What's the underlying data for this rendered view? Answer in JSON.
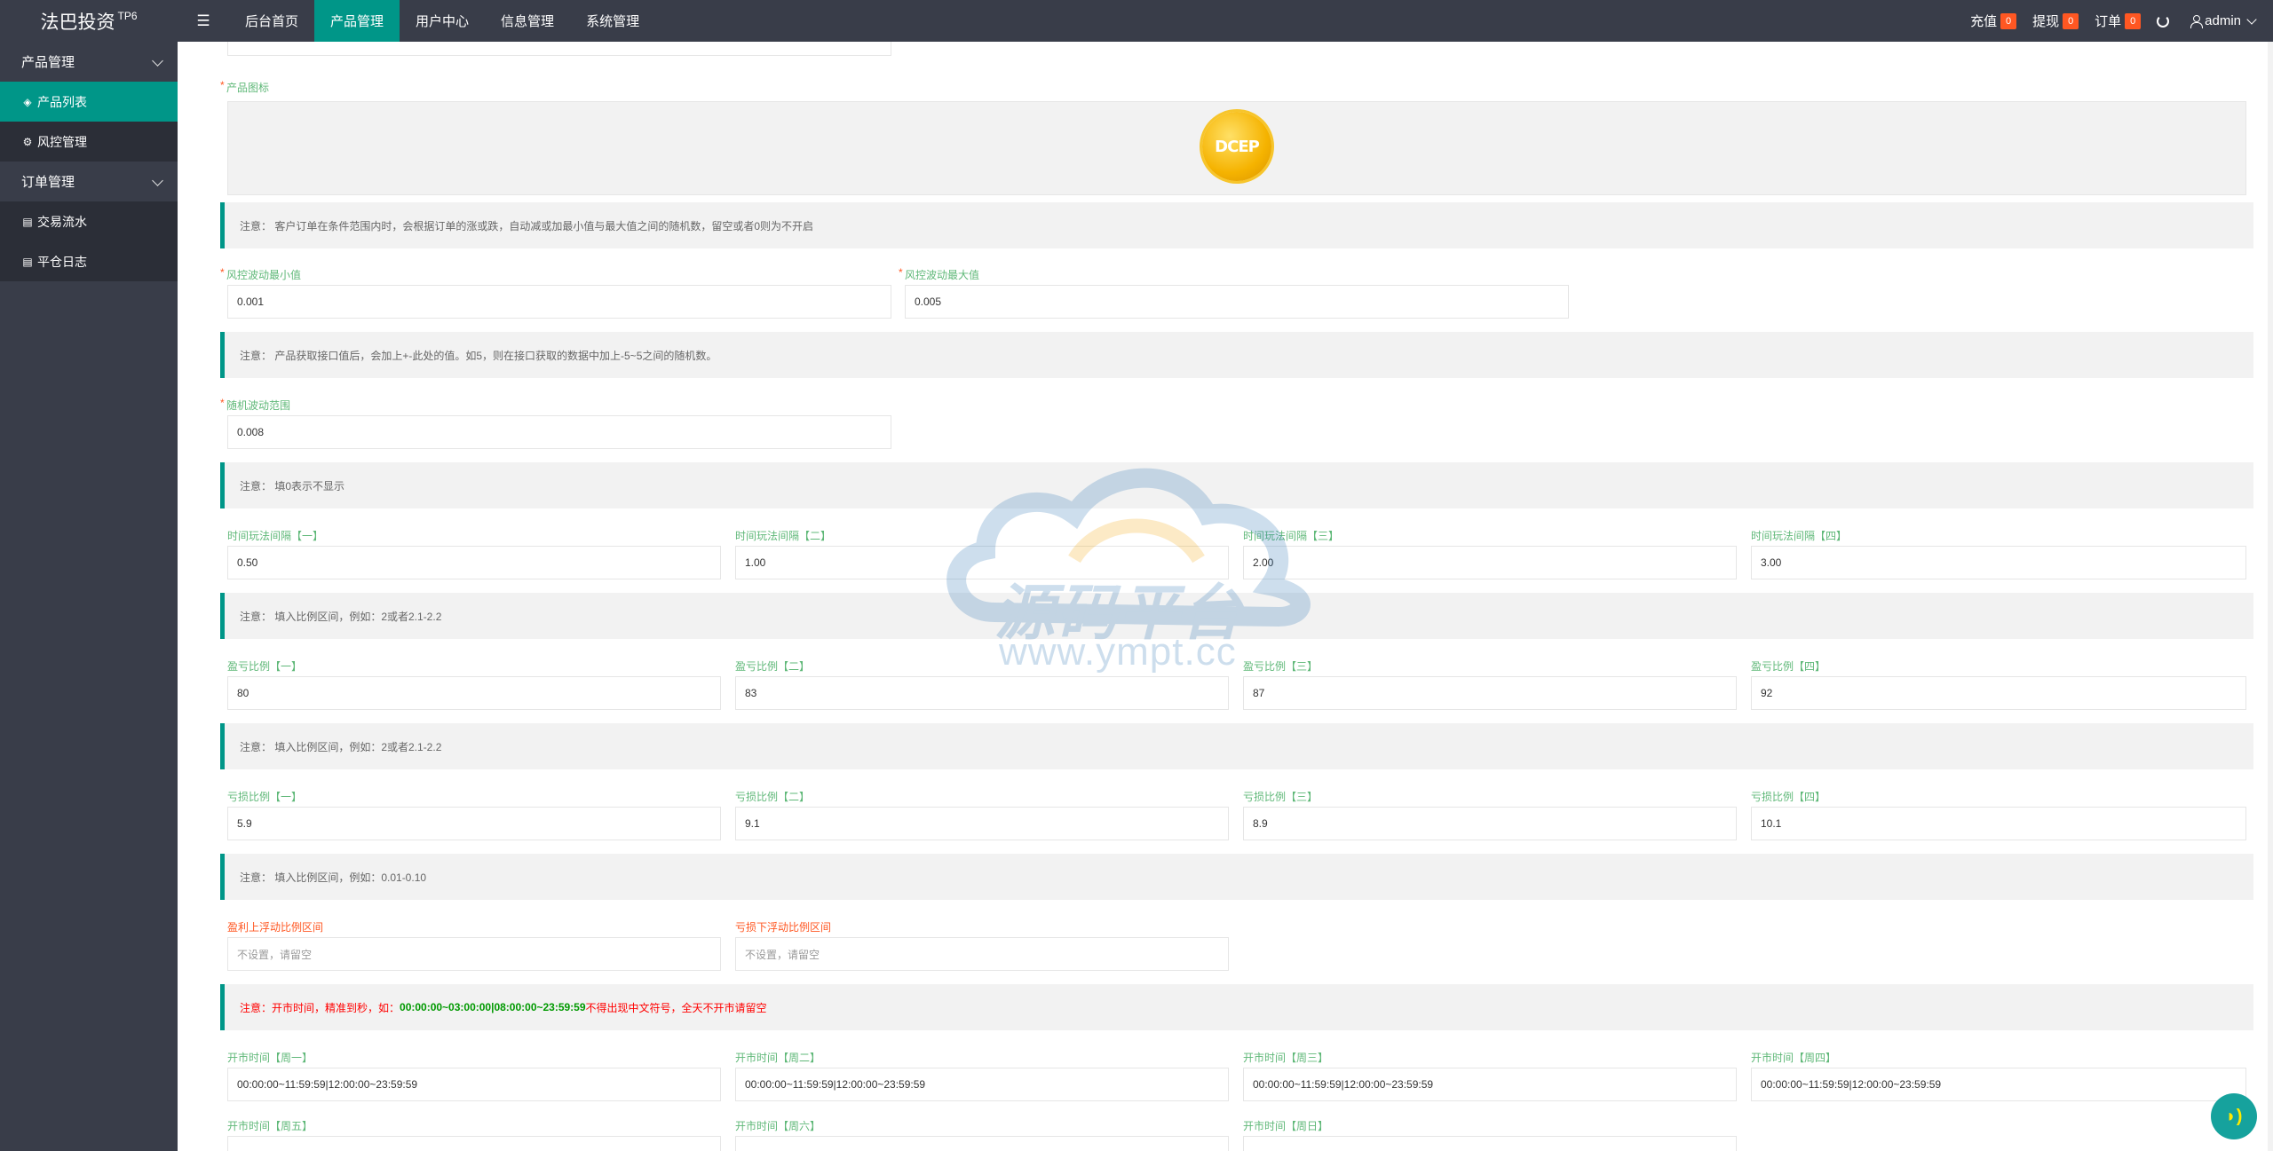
{
  "header": {
    "logo": "法巴投资",
    "logo_sup": "TP6",
    "nav": [
      "后台首页",
      "产品管理",
      "用户中心",
      "信息管理",
      "系统管理"
    ],
    "active_nav": "产品管理",
    "recharge_label": "充值",
    "recharge_count": "0",
    "withdraw_label": "提现",
    "withdraw_count": "0",
    "order_label": "订单",
    "order_count": "0",
    "user": "admin"
  },
  "sidebar": {
    "group1": "产品管理",
    "item1": "产品列表",
    "item2": "风控管理",
    "group2": "订单管理",
    "item3": "交易流水",
    "item4": "平仓日志"
  },
  "form": {
    "icon_label": "产品图标",
    "icon_text": "DCEP",
    "note1": "注意：  客户订单在条件范围内时，会根据订单的涨或跌，自动减或加最小值与最大值之间的随机数，留空或者0则为不开启",
    "risk_min_label": "风控波动最小值",
    "risk_min": "0.001",
    "risk_max_label": "风控波动最大值",
    "risk_max": "0.005",
    "note2": "注意：  产品获取接口值后，会加上+-此处的值。如5，则在接口获取的数据中加上-5~5之间的随机数。",
    "random_label": "随机波动范围",
    "random": "0.008",
    "note3": "注意：  填0表示不显示",
    "interval_labels": [
      "时间玩法间隔【一】",
      "时间玩法间隔【二】",
      "时间玩法间隔【三】",
      "时间玩法间隔【四】"
    ],
    "interval_values": [
      "0.50",
      "1.00",
      "2.00",
      "3.00"
    ],
    "note4": "注意：  填入比例区间，例如：2或者2.1-2.2",
    "profit_labels": [
      "盈亏比例【一】",
      "盈亏比例【二】",
      "盈亏比例【三】",
      "盈亏比例【四】"
    ],
    "profit_values": [
      "80",
      "83",
      "87",
      "92"
    ],
    "note5": "注意：  填入比例区间，例如：2或者2.1-2.2",
    "loss_labels": [
      "亏损比例【一】",
      "亏损比例【二】",
      "亏损比例【三】",
      "亏损比例【四】"
    ],
    "loss_values": [
      "5.9",
      "9.1",
      "8.9",
      "10.1"
    ],
    "note6": "注意：  填入比例区间，例如：0.01-0.10",
    "float_up_label": "盈利上浮动比例区间",
    "float_down_label": "亏损下浮动比例区间",
    "float_placeholder": "不设置，请留空",
    "note7_prefix": "注意：开市时间，精准到秒，如：",
    "note7_example": "00:00:00~03:00:00|08:00:00~23:59:59",
    "note7_suffix": " 不得出现中文符号，全天不开市请留空",
    "open_labels": [
      "开市时间【周一】",
      "开市时间【周二】",
      "开市时间【周三】",
      "开市时间【周四】",
      "开市时间【周五】",
      "开市时间【周六】",
      "开市时间【周日】"
    ],
    "open_value": "00:00:00~11:59:59|12:00:00~23:59:59"
  },
  "watermark": {
    "text": "源码平台",
    "url": "www.ympt.cc"
  },
  "colors": {
    "header_bg": "#393d49",
    "accent": "#009688",
    "badge": "#ff5722",
    "label_green": "#5fb878"
  }
}
